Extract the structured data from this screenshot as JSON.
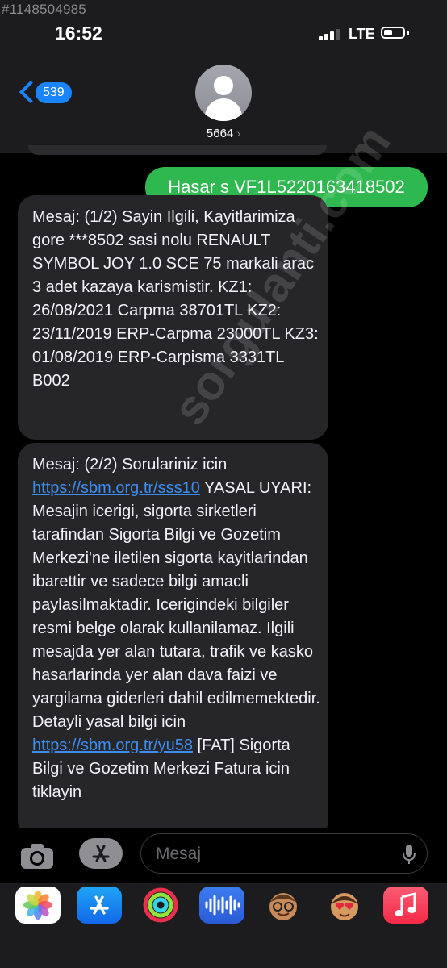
{
  "watermark_id": "#1148504985",
  "status": {
    "time": "16:52",
    "network": "LTE"
  },
  "header": {
    "back_count": "539",
    "contact": "5664",
    "contact_chevron": "›"
  },
  "messages": {
    "sent_1": "Hasar s VF1L5220163418502",
    "recv_1": "Mesaj: (1/2) Sayin Ilgili, Kayitlarimiza gore ***8502 sasi nolu RENAULT SYMBOL JOY 1.0 SCE 75 markali arac 3 adet kazaya karismistir. KZ1: 26/08/2021 Carpma 38701TL KZ2: 23/11/2019 ERP-Carpma 23000TL KZ3: 01/08/2019 ERP-Carpisma 3331TL B002",
    "recv_2_a": "Mesaj: (2/2) Sorulariniz icin",
    "recv_2_link1": "https://sbm.org.tr/sss10",
    "recv_2_b": " YASAL UYARI: Mesajin icerigi, sigorta sirketleri tarafindan Sigorta Bilgi ve Gozetim Merkezi'ne iletilen sigorta kayitlarindan ibarettir ve sadece bilgi amacli paylasilmaktadir. Icerigindeki bilgiler resmi belge olarak kullanilamaz. Ilgili mesajda yer alan tutara, trafik ve kasko hasarlarinda yer alan dava faizi ve yargilama giderleri dahil edilmemektedir. Detayli yasal bilgi icin ",
    "recv_2_link2": "https://sbm.org.tr/yu58",
    "recv_2_c": " [FAT] Sigorta Bilgi ve Gozetim Merkezi Fatura icin tiklayin"
  },
  "watermark_text": "sorgulanti.com",
  "input": {
    "placeholder": "Mesaj"
  },
  "icons": {
    "camera": "camera-icon",
    "apps": "app-store-icon",
    "mic": "microphone-icon",
    "strip": [
      "photos-icon",
      "app-store-icon",
      "fitness-icon",
      "audio-icon",
      "memoji-icon",
      "memoji-2-icon",
      "music-icon"
    ]
  },
  "colors": {
    "sent_bubble": "#2fb84f",
    "received_bubble": "#262629",
    "link": "#3b8df0",
    "accent": "#1a84ff"
  }
}
